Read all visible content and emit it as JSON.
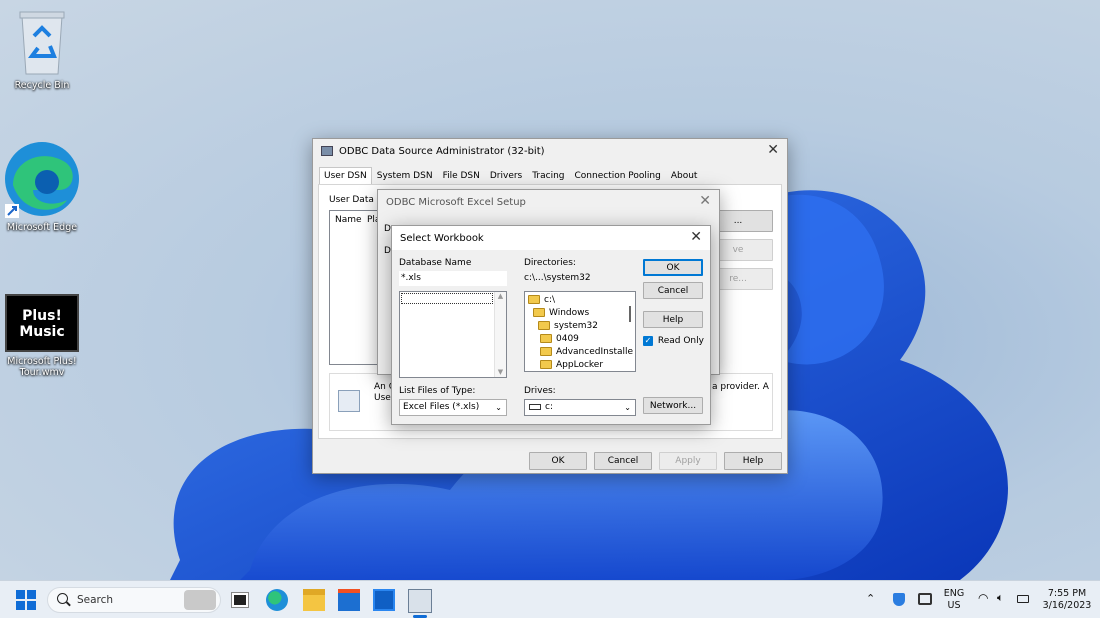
{
  "desktop": {
    "icons": [
      {
        "label": "Recycle Bin"
      },
      {
        "label": "Microsoft Edge"
      },
      {
        "label": "Microsoft Plus! Tour.wmv"
      }
    ],
    "plus_icon_text": "Plus! Music"
  },
  "odbc": {
    "title": "ODBC Data Source Administrator (32-bit)",
    "tabs": [
      "User DSN",
      "System DSN",
      "File DSN",
      "Drivers",
      "Tracing",
      "Connection Pooling",
      "About"
    ],
    "user_data_sources_label": "User Data So",
    "col_name": "Name",
    "col_platform": "Pla",
    "info_text_left": "An O",
    "info_text_left2": "User",
    "info_text_right": "a provider.  A",
    "buttons": {
      "ok": "OK",
      "cancel": "Cancel",
      "apply": "Apply",
      "help": "Help"
    },
    "side_btn_1": "...",
    "side_btn_2": "ve",
    "side_btn_3": "re..."
  },
  "excel_setup": {
    "title": "ODBC Microsoft Excel Setup",
    "frag_1": "Da",
    "frag_2": "De"
  },
  "select_workbook": {
    "title": "Select Workbook",
    "database_name_label": "Database Name",
    "database_name_value": "*.xls",
    "directories_label": "Directories:",
    "current_dir": "c:\\...\\system32",
    "directories": [
      "c:\\",
      "Windows",
      "system32",
      "0409",
      "AdvancedInstalle",
      "AppLocker"
    ],
    "list_files_label": "List Files of Type:",
    "file_type_value": "Excel Files (*.xls)",
    "drives_label": "Drives:",
    "drive_value": "c:",
    "buttons": {
      "ok": "OK",
      "cancel": "Cancel",
      "help": "Help",
      "network": "Network..."
    },
    "read_only_label": "Read Only",
    "read_only_checked": true
  },
  "taskbar": {
    "search_placeholder": "Search",
    "lang_line1": "ENG",
    "lang_line2": "US",
    "time": "7:55 PM",
    "date": "3/16/2023"
  },
  "colors": {
    "accent": "#0078d4",
    "wallpaper_bloom": "#1a56d6"
  }
}
